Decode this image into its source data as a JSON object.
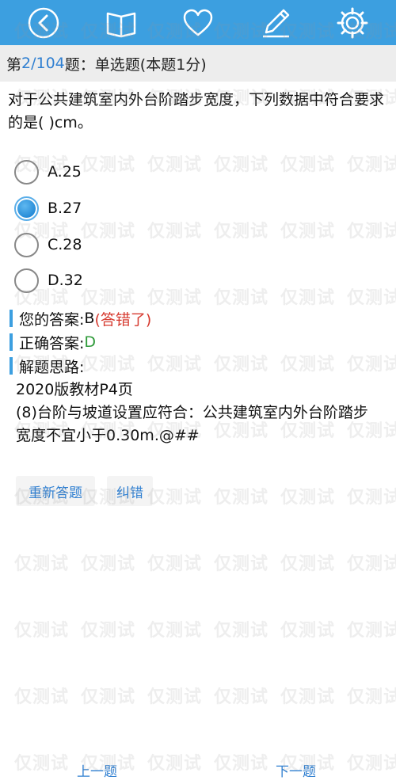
{
  "toolbar": {
    "icons": [
      "back-icon",
      "book-icon",
      "heart-icon",
      "pencil-icon",
      "gear-icon"
    ]
  },
  "question": {
    "prefix": "第 ",
    "number": "2/104",
    "suffix": " 题：单选题(本题1分)",
    "stem": "对于公共建筑室内外台阶踏步宽度，下列数据中符合要求的是( )cm。"
  },
  "options": [
    {
      "label": "A.25",
      "selected": false
    },
    {
      "label": "B.27",
      "selected": true
    },
    {
      "label": "C.28",
      "selected": false
    },
    {
      "label": "D.32",
      "selected": false
    }
  ],
  "answer": {
    "yours_label": "您的答案:",
    "yours_value": "B",
    "yours_status": "(答错了)",
    "correct_label": "正确答案:",
    "correct_value": "D",
    "explain_label": "解题思路:",
    "explain_lines": [
      "2020版教材P4页",
      "(8)台阶与坡道设置应符合：公共建筑室内外台阶踏步宽度不宜小于0.30m.@##"
    ]
  },
  "actions": {
    "retry": "重新答题",
    "report": "纠错"
  },
  "nav": {
    "prev": "上一题",
    "next": "下一题"
  },
  "watermark": {
    "text": "仅测试"
  },
  "colors": {
    "toolbar": "#3c9fe0",
    "accent": "#2f7fd1",
    "wrong": "#d63a2f",
    "right": "#2e9a39"
  }
}
